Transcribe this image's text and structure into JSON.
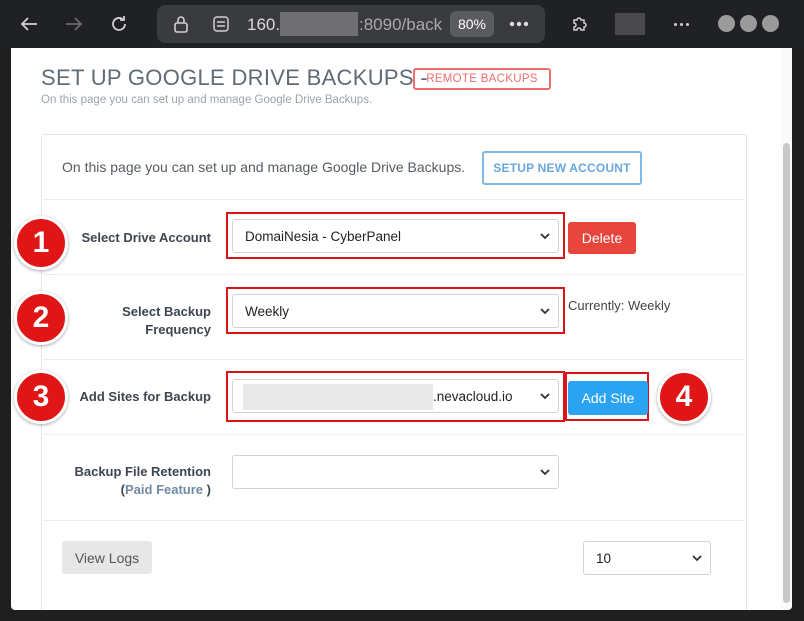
{
  "browser": {
    "url_visible_start": "160.",
    "url_visible_end": ":8090/back",
    "zoom": "80%"
  },
  "page": {
    "title": "SET UP GOOGLE DRIVE BACKUPS -",
    "badge": "REMOTE BACKUPS",
    "subtitle": "On this page you can set up and manage Google Drive Backups."
  },
  "panel": {
    "intro": "On this page you can set up and manage Google Drive Backups.",
    "setup_button": "SETUP NEW ACCOUNT",
    "drive_account": {
      "label": "Select Drive Account",
      "value": "DomaiNesia - CyberPanel",
      "delete_button": "Delete"
    },
    "frequency": {
      "label_line1": "Select Backup",
      "label_line2": "Frequency",
      "value": "Weekly",
      "current": "Currently: Weekly"
    },
    "sites": {
      "label": "Add Sites for Backup",
      "value_suffix": ".nevacloud.io",
      "add_button": "Add Site"
    },
    "retention": {
      "label": "Backup File Retention",
      "paid_prefix": "(",
      "paid_text": "Paid Feature",
      "paid_suffix": " )",
      "value": ""
    },
    "view_logs_button": "View Logs",
    "page_size": "10"
  },
  "callouts": [
    "1",
    "2",
    "3",
    "4"
  ],
  "colors": {
    "callout_red": "#e01616",
    "highlight_red": "#d9141b",
    "delete_red": "#e8453c",
    "primary_blue": "#2aa3f2",
    "badge_red": "#f06d6d"
  }
}
